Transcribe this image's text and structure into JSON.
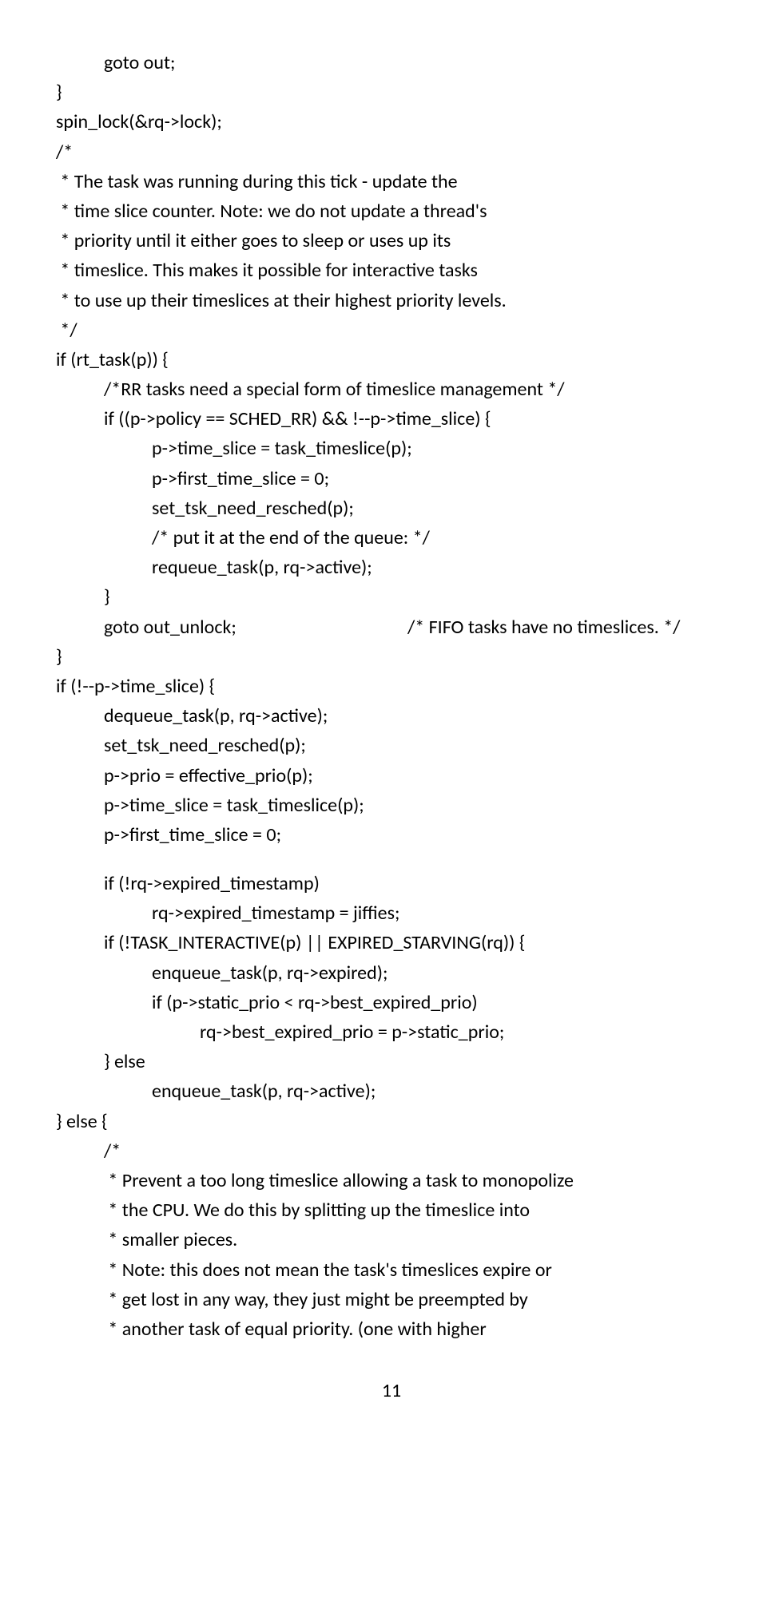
{
  "lines": {
    "l01": "goto out;",
    "l02": "}",
    "l03": "spin_lock(&rq->lock);",
    "l04": "/*",
    "l05": " * The task was running during this tick - update the",
    "l06": " * time slice counter. Note: we do not update a thread's",
    "l07": " * priority until it either goes to sleep or uses up its",
    "l08": " * timeslice. This makes it possible for interactive tasks",
    "l09": " * to use up their timeslices at their highest priority levels.",
    "l10": " */",
    "l11": "if (rt_task(p)) {",
    "l12": "/*RR tasks need a special form of timeslice management */",
    "l13": "if ((p->policy == SCHED_RR) && !--p->time_slice) {",
    "l14": "p->time_slice = task_timeslice(p);",
    "l15": "p->first_time_slice = 0;",
    "l16": "set_tsk_need_resched(p);",
    "l17": "/* put it at the end of the queue: */",
    "l18": "requeue_task(p, rq->active);",
    "l19": "}",
    "l20a": "goto out_unlock;",
    "l20b": "/* FIFO tasks have no timeslices. */",
    "l21": "}",
    "l22": "if (!--p->time_slice) {",
    "l23": "dequeue_task(p, rq->active);",
    "l24": "set_tsk_need_resched(p);",
    "l25": "p->prio = effective_prio(p);",
    "l26": "p->time_slice = task_timeslice(p);",
    "l27": "p->first_time_slice = 0;",
    "l28": "if (!rq->expired_timestamp)",
    "l29": "rq->expired_timestamp = jiffies;",
    "l30": "if (!TASK_INTERACTIVE(p) || EXPIRED_STARVING(rq)) {",
    "l31": "enqueue_task(p, rq->expired);",
    "l32": "if (p->static_prio < rq->best_expired_prio)",
    "l33": "rq->best_expired_prio = p->static_prio;",
    "l34": "} else",
    "l35": "enqueue_task(p, rq->active);",
    "l36": "} else {",
    "l37": "/*",
    "l38": " * Prevent a too long timeslice allowing a task to monopolize",
    "l39": " * the CPU. We do this by splitting up the timeslice into",
    "l40": " * smaller pieces.",
    "l41": " * Note: this does not mean the task's timeslices expire or",
    "l42": " * get lost in any way, they just might be preempted by",
    "l43": " * another task of equal priority. (one with higher"
  },
  "pagenum": "11"
}
